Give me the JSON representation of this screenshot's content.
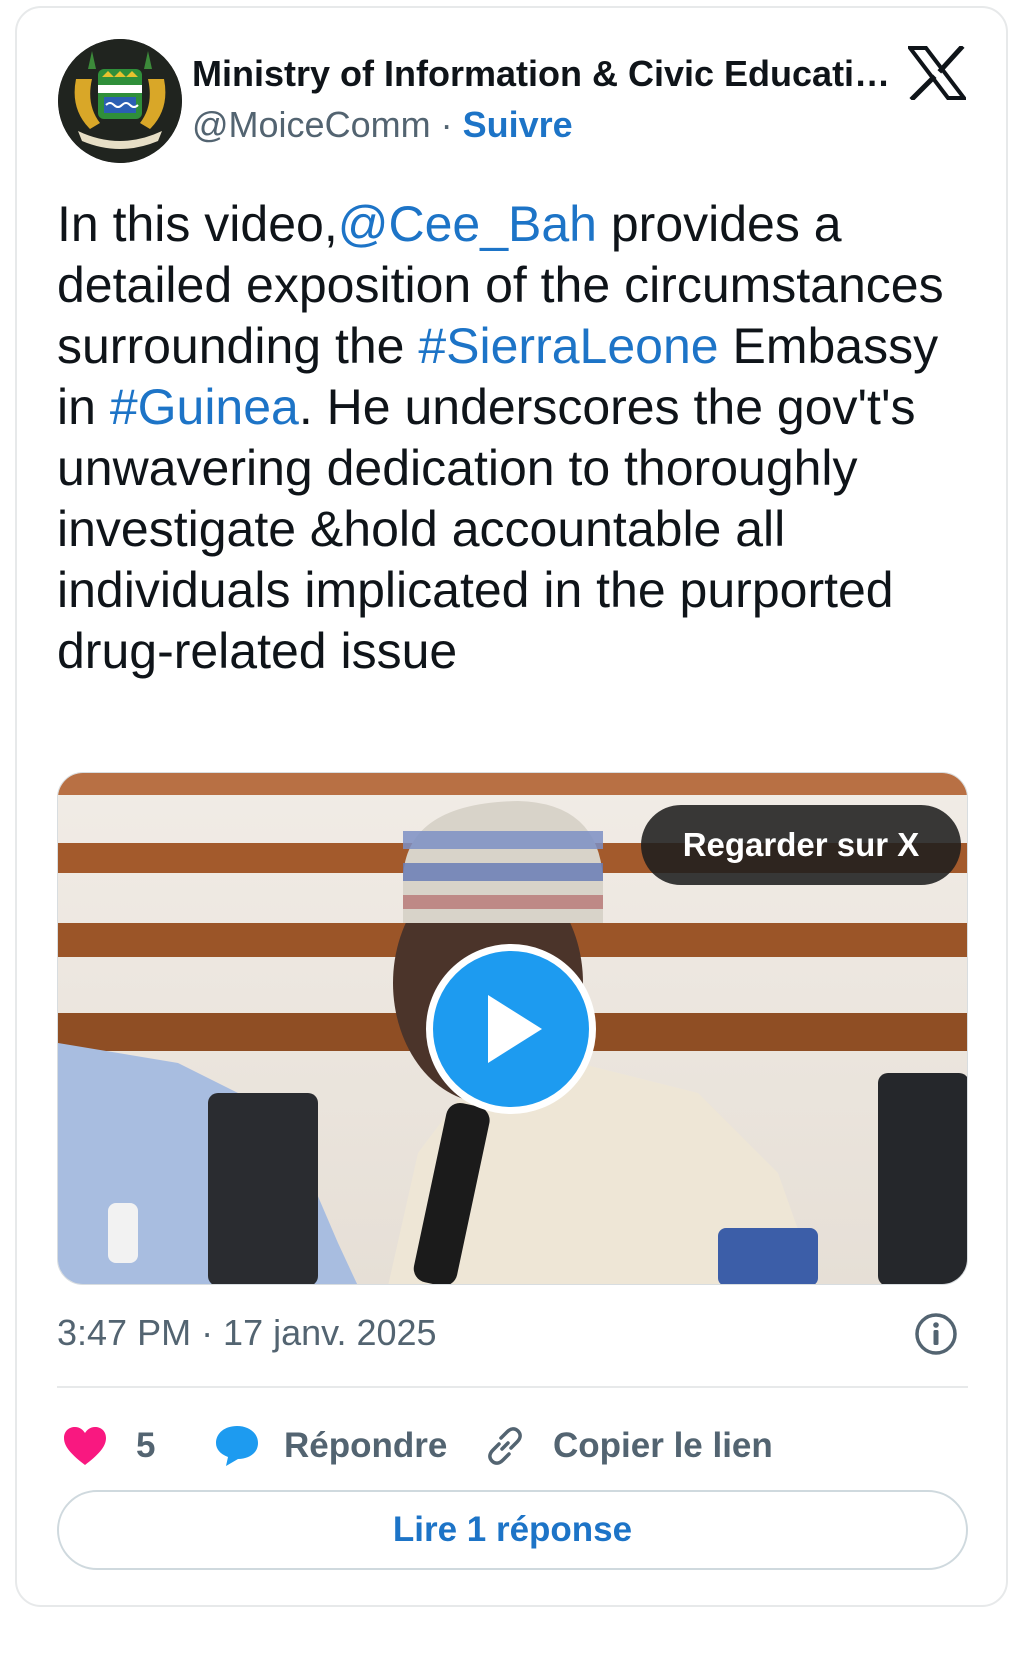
{
  "author": {
    "name": "Ministry of Information & Civic Educati…",
    "handle": "@MoiceComm",
    "separator": " · ",
    "follow_label": "Suivre"
  },
  "tweet": {
    "segments": [
      {
        "text": "In this video,",
        "link": false
      },
      {
        "text": "@Cee_Bah",
        "link": true
      },
      {
        "text": " provides a detailed exposition of the circumstances surrounding the ",
        "link": false
      },
      {
        "text": "#SierraLeone",
        "link": true
      },
      {
        "text": " Embassy in ",
        "link": false
      },
      {
        "text": "#Guinea",
        "link": true
      },
      {
        "text": ". He underscores the gov't's unwavering dedication to thoroughly investigate &hold accountable all individuals implicated in the purported drug-related issue",
        "link": false
      }
    ]
  },
  "media": {
    "watch_label": "Regarder sur X"
  },
  "meta": {
    "timestamp": "3:47 PM · 17 janv. 2025"
  },
  "actions": {
    "like_count": "5",
    "reply_label": "Répondre",
    "copy_label": "Copier le lien"
  },
  "read_replies_label": "Lire 1 réponse",
  "colors": {
    "link": "#1d74c7",
    "play": "#1d9bf0",
    "like": "#f91880",
    "muted": "#536471"
  },
  "icons": [
    "x-logo-icon",
    "play-icon",
    "info-icon",
    "heart-icon",
    "reply-bubble-icon",
    "link-icon"
  ]
}
